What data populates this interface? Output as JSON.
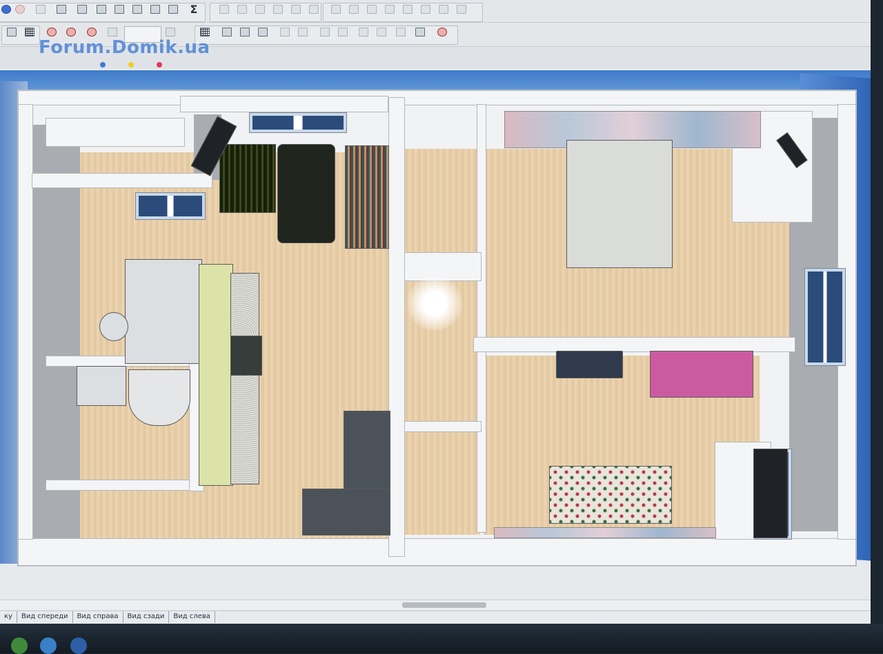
{
  "watermark": "Forum.Domik.ua",
  "toolbar_icons": [
    "sigma-icon"
  ],
  "sigma_glyph": "Σ",
  "view_tabs": [
    "Вид спереди",
    "Вид справа",
    "Вид сзади",
    "Вид слева"
  ],
  "first_tab_fragment": "ку",
  "colors": {
    "accent_blue": "#3e7bd6",
    "sky": "#3d7ac9",
    "floor": "#e8cfa9",
    "sofa_pink": "#cc5aa1",
    "sofa_grey": "#4b525a"
  }
}
